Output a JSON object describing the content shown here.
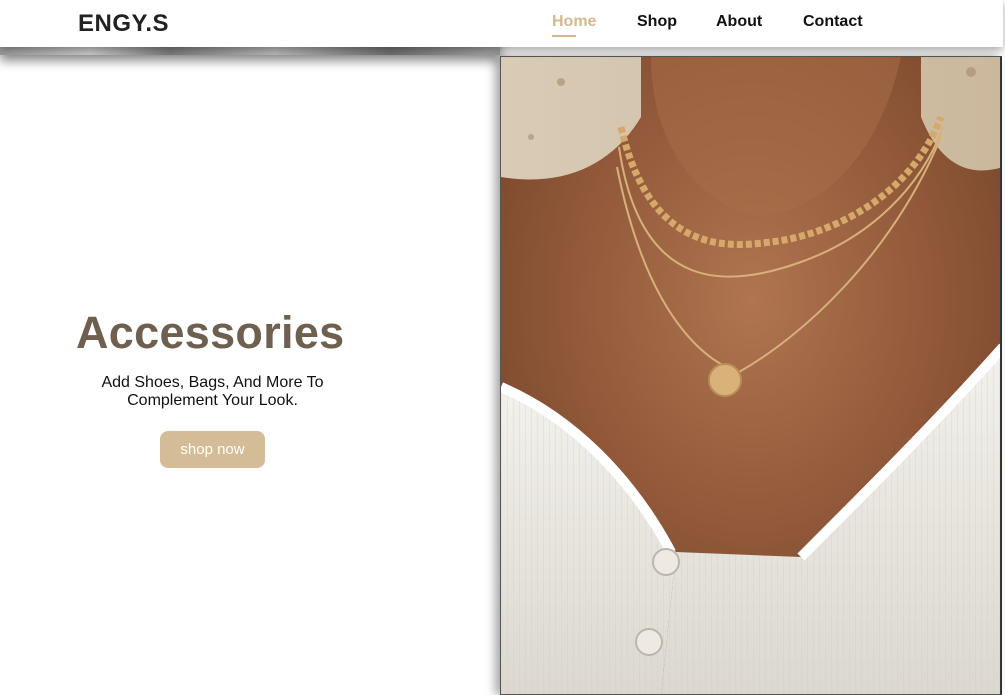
{
  "brand": {
    "logo": "ENGY.S"
  },
  "nav": {
    "items": [
      {
        "label": "Home",
        "active": true
      },
      {
        "label": "Shop",
        "active": false
      },
      {
        "label": "About",
        "active": false
      },
      {
        "label": "Contact",
        "active": false
      }
    ]
  },
  "hero": {
    "title": "Accessories",
    "subtitle": "Add Shoes, Bags, And More To Complement Your Look.",
    "cta_label": "shop now",
    "image_icon": "necklace-photo"
  },
  "colors": {
    "accent": "#d4b890",
    "title": "#6e5f4e",
    "button": "#d4bc96",
    "text": "#111111"
  }
}
